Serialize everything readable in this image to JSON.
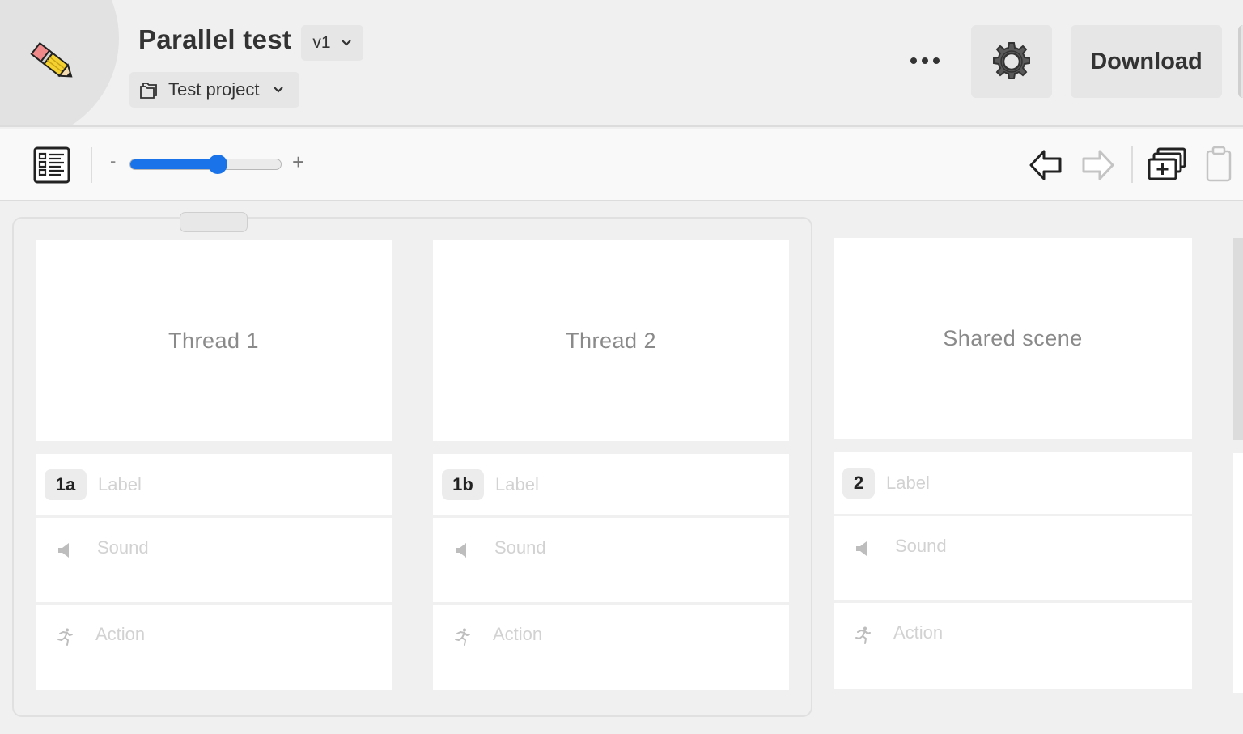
{
  "header": {
    "title": "Parallel test",
    "version": "v1",
    "project": "Test project",
    "download_label": "Download",
    "icons": {
      "logo": "pencil-icon",
      "version_dropdown": "chevron-down-icon",
      "project": "folder-icon",
      "more": "more-horizontal-icon",
      "settings": "gear-icon"
    }
  },
  "toolbar": {
    "zoom_minus": "-",
    "zoom_plus": "+",
    "zoom_level": 0.58,
    "accent_color": "#1a73e8",
    "icons": [
      "storyboard-list-icon",
      "undo-arrow-icon",
      "redo-arrow-icon",
      "add-frames-icon",
      "clipboard-icon"
    ]
  },
  "frames": [
    {
      "scene": "Thread 1",
      "number": "1a",
      "label_placeholder": "Label",
      "sound_placeholder": "Sound",
      "action_placeholder": "Action"
    },
    {
      "scene": "Thread 2",
      "number": "1b",
      "label_placeholder": "Label",
      "sound_placeholder": "Sound",
      "action_placeholder": "Action"
    },
    {
      "scene": "Shared scene",
      "number": "2",
      "label_placeholder": "Label",
      "sound_placeholder": "Sound",
      "action_placeholder": "Action"
    }
  ]
}
